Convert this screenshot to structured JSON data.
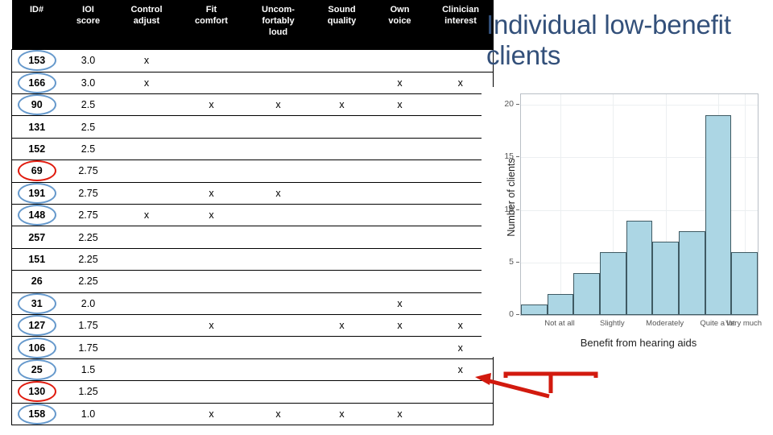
{
  "slide": {
    "title": "Individual low-benefit clients"
  },
  "table": {
    "columns": [
      {
        "key": "id",
        "label": "ID#"
      },
      {
        "key": "ioi",
        "label": "IOI score"
      },
      {
        "key": "control",
        "label": "Control adjust"
      },
      {
        "key": "fit",
        "label": "Fit comfort"
      },
      {
        "key": "loud",
        "label": "Uncom-fortably loud"
      },
      {
        "key": "sound",
        "label": "Sound quality"
      },
      {
        "key": "voice",
        "label": "Own voice"
      },
      {
        "key": "clinician",
        "label": "Clinician interest"
      }
    ],
    "mark": "x",
    "rows": [
      {
        "id": "153",
        "ioi": "3.0",
        "highlight": "blue",
        "marks": [
          "x",
          "",
          "",
          "",
          "",
          ""
        ]
      },
      {
        "id": "166",
        "ioi": "3.0",
        "highlight": "blue",
        "marks": [
          "x",
          "",
          "",
          "",
          "x",
          "x"
        ]
      },
      {
        "id": "90",
        "ioi": "2.5",
        "highlight": "blue",
        "marks": [
          "",
          "x",
          "x",
          "x",
          "x",
          ""
        ]
      },
      {
        "id": "131",
        "ioi": "2.5",
        "highlight": "none",
        "marks": [
          "",
          "",
          "",
          "",
          "",
          ""
        ]
      },
      {
        "id": "152",
        "ioi": "2.5",
        "highlight": "none",
        "marks": [
          "",
          "",
          "",
          "",
          "",
          ""
        ]
      },
      {
        "id": "69",
        "ioi": "2.75",
        "highlight": "red",
        "marks": [
          "",
          "",
          "",
          "",
          "",
          ""
        ]
      },
      {
        "id": "191",
        "ioi": "2.75",
        "highlight": "blue",
        "marks": [
          "",
          "x",
          "x",
          "",
          "",
          ""
        ]
      },
      {
        "id": "148",
        "ioi": "2.75",
        "highlight": "blue",
        "marks": [
          "x",
          "x",
          "",
          "",
          "",
          ""
        ]
      },
      {
        "id": "257",
        "ioi": "2.25",
        "highlight": "none",
        "marks": [
          "",
          "",
          "",
          "",
          "",
          ""
        ]
      },
      {
        "id": "151",
        "ioi": "2.25",
        "highlight": "none",
        "marks": [
          "",
          "",
          "",
          "",
          "",
          ""
        ]
      },
      {
        "id": "26",
        "ioi": "2.25",
        "highlight": "none",
        "marks": [
          "",
          "",
          "",
          "",
          "",
          ""
        ]
      },
      {
        "id": "31",
        "ioi": "2.0",
        "highlight": "blue",
        "marks": [
          "",
          "",
          "",
          "",
          "x",
          ""
        ]
      },
      {
        "id": "127",
        "ioi": "1.75",
        "highlight": "blue",
        "marks": [
          "",
          "x",
          "",
          "x",
          "x",
          "x"
        ]
      },
      {
        "id": "106",
        "ioi": "1.75",
        "highlight": "blue",
        "marks": [
          "",
          "",
          "",
          "",
          "",
          "x"
        ]
      },
      {
        "id": "25",
        "ioi": "1.5",
        "highlight": "blue",
        "marks": [
          "",
          "",
          "",
          "",
          "",
          "x"
        ]
      },
      {
        "id": "130",
        "ioi": "1.25",
        "highlight": "red",
        "marks": [
          "",
          "",
          "",
          "",
          "",
          ""
        ]
      },
      {
        "id": "158",
        "ioi": "1.0",
        "highlight": "blue",
        "marks": [
          "",
          "x",
          "x",
          "x",
          "x",
          ""
        ]
      }
    ]
  },
  "chart_data": {
    "type": "bar",
    "title": "",
    "xlabel": "Benefit from hearing aids",
    "ylabel": "Number of clients",
    "categories": [
      "",
      "Not at all",
      "",
      "Slightly",
      "",
      "Moderately",
      "",
      "Quite a lot",
      "Very much"
    ],
    "tick_labels": [
      "Not at all",
      "Slightly",
      "Moderately",
      "Quite a lot",
      "Very much"
    ],
    "values": [
      1,
      2,
      4,
      6,
      9,
      7,
      8,
      19,
      6
    ],
    "ylim": [
      0,
      21
    ],
    "yticks": [
      0,
      5,
      10,
      15,
      20
    ],
    "grid": true,
    "legend": "none",
    "bar_fill": "#ACD6E4",
    "bar_border": "#3f5a63"
  },
  "annotation": {
    "bracket_color": "#D21A0E",
    "arrow_color": "#D21A0E",
    "name": "low-benefit-callout"
  },
  "colors": {
    "title": "#33507A",
    "highlight_blue": "#6699CC",
    "highlight_red": "#E01B0E",
    "header_bg": "#000000"
  }
}
